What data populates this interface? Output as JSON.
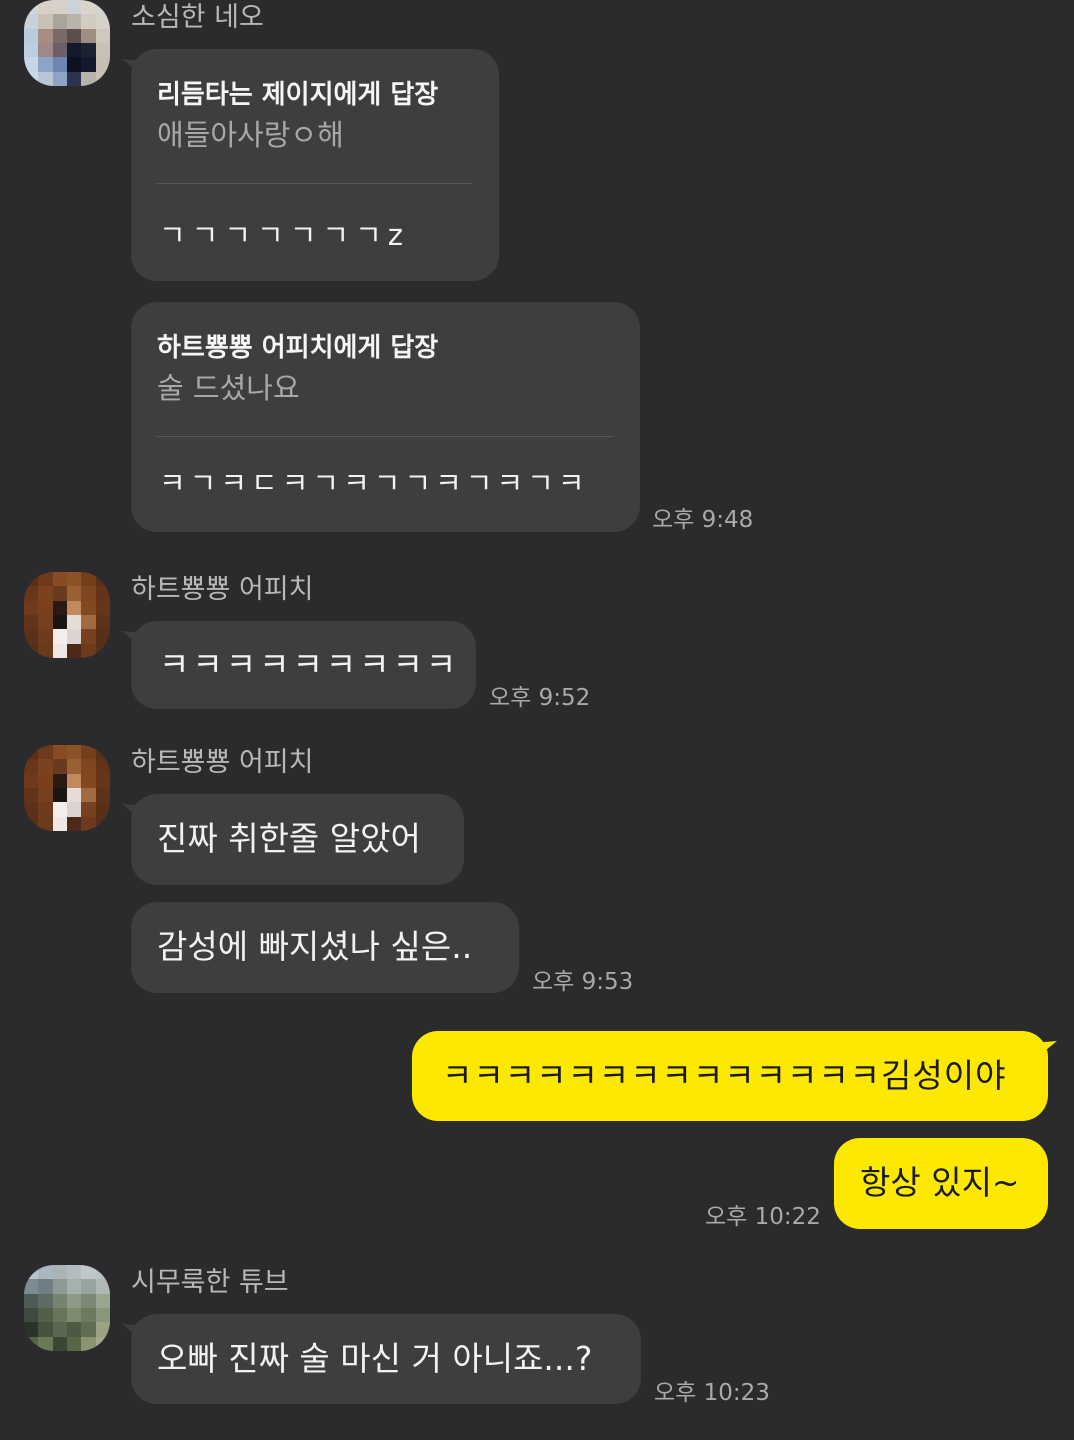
{
  "colors": {
    "background": "#2b2b2d",
    "other_bubble": "#3e3e40",
    "my_bubble": "#fde800",
    "name_text": "#b7b7b9",
    "time_text": "#a9a9ab"
  },
  "messages": {
    "g1": {
      "sender": "소심한 네오",
      "reply1": {
        "header": "리듬타는 제이지에게 답장",
        "quote": "애들아사랑ㅇ해",
        "body": "ㄱㄱㄱㄱㄱㄱㄱz"
      },
      "reply2": {
        "header": "하트뿅뿅 어피치에게 답장",
        "quote": "술 드셨나요",
        "body": "ㅋㄱㅋㄷㅋㄱㅋㄱㄱㅋㄱㅋㄱㅋ"
      },
      "time": "오후 9:48"
    },
    "g2": {
      "sender": "하트뿅뿅 어피치",
      "text": "ㅋㅋㅋㅋㅋㅋㅋㅋㅋ",
      "time": "오후 9:52"
    },
    "g3": {
      "sender": "하트뿅뿅 어피치",
      "text1": "진짜 취한줄 알았어",
      "text2": "감성에 빠지셨나 싶은..",
      "time": "오후 9:53"
    },
    "g4": {
      "text1": "ㅋㅋㅋㅋㅋㅋㅋㅋㅋㅋㅋㅋㅋㅋ김성이야",
      "text2": "항상 있지~",
      "time": "오후 10:22"
    },
    "g5": {
      "sender": "시무룩한 튜브",
      "text": "오빠 진짜 술 마신 거 아니죠...?",
      "time": "오후 10:23"
    }
  }
}
